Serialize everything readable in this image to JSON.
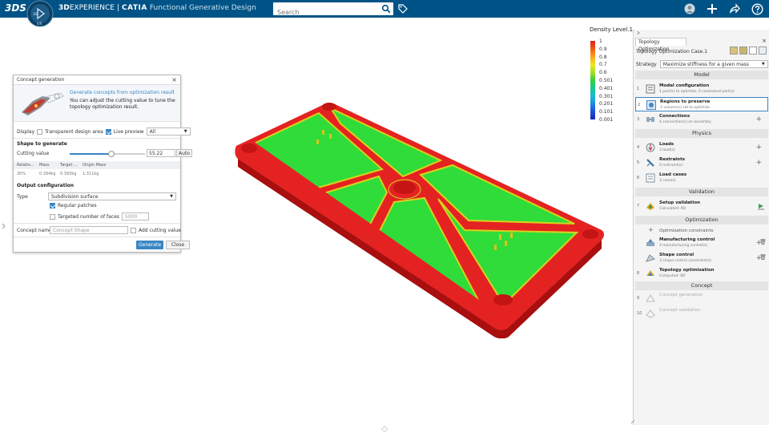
{
  "topbar": {
    "logo": "3DS",
    "compass_label": "V.R",
    "brand_bold": "3D",
    "brand_rest": "EXPERIENCE",
    "separator": "|",
    "app": "CATIA",
    "app_sub": "Functional Generative Design",
    "search_placeholder": "Search"
  },
  "dialog": {
    "title": "Concept generation",
    "head_title": "Generate concepts from optimization result",
    "head_text": "You can adjust the cutting value to tune the topology optimization result.",
    "display_label": "Display",
    "transparent_label": "Transparent design area",
    "live_preview_label": "Live preview",
    "display_select": "All",
    "shape_section": "Shape to generate",
    "cutting_label": "Cutting value",
    "cutting_value": "55.22",
    "cutting_fraction": 0.55,
    "auto_label": "Auto",
    "table_headers": [
      "Relativ...",
      "Mass",
      "Target ...",
      "Origin Mass"
    ],
    "table_values": [
      "30%",
      "0.394kg",
      "0.393kg",
      "1.311kg"
    ],
    "output_section": "Output configuration",
    "type_label": "Type",
    "type_value": "Subdivision surface",
    "regular_patches_label": "Regular patches",
    "targeted_faces_label": "Targeted number of faces",
    "targeted_faces_value": "5000",
    "concept_name_label": "Concept name",
    "concept_name_placeholder": "Concept Shape",
    "add_cutting_label": "Add cutting value",
    "generate_label": "Generate",
    "close_label": "Close"
  },
  "legend": {
    "title": "Density Level.1",
    "labels": [
      "1",
      "0.9",
      "0.8",
      "0.7",
      "0.6",
      "0.501",
      "0.401",
      "0.301",
      "0.201",
      "0.101",
      "0.001"
    ]
  },
  "panel": {
    "tab": "Topology Optimization",
    "case": "Topology Optimization Case.1",
    "strategy_label": "Strategy",
    "strategy_value": "Maximize stiffness for a given mass",
    "sections": {
      "model": "Model",
      "physics": "Physics",
      "validation": "Validation",
      "optimization": "Optimization",
      "concept": "Concept"
    },
    "items": {
      "model_config": {
        "num": "1",
        "title": "Model configuration",
        "sub": "1 part(s) to optimize, 0 contextual part(s)"
      },
      "regions": {
        "num": "2",
        "title": "Regions to preserve",
        "sub": "2 volume(s) set to optimize"
      },
      "connections": {
        "num": "3",
        "title": "Connections",
        "sub": "4 connection(s) on assembly"
      },
      "loads": {
        "num": "4",
        "title": "Loads",
        "sub": "3 load(s)"
      },
      "restraints": {
        "num": "5",
        "title": "Restraints",
        "sub": "0 restraint(s)"
      },
      "load_cases": {
        "num": "6",
        "title": "Load cases",
        "sub": "3 case(s)"
      },
      "setup_validation": {
        "num": "7",
        "title": "Setup validation",
        "sub": "Calculated: KO"
      },
      "opt_constraints": {
        "title": "Optimization constraints"
      },
      "manufacturing": {
        "title": "Manufacturing control",
        "sub": "3 manufacturing control(s)"
      },
      "shape_control": {
        "title": "Shape control",
        "sub": "3 shape control constraint(s)"
      },
      "topology_opt": {
        "num": "8",
        "title": "Topology optimization",
        "sub": "Computed: KO"
      },
      "concept_gen": {
        "num": "9",
        "title": "Concept generation"
      },
      "concept_val": {
        "num": "10",
        "title": "Concept validation"
      }
    }
  }
}
